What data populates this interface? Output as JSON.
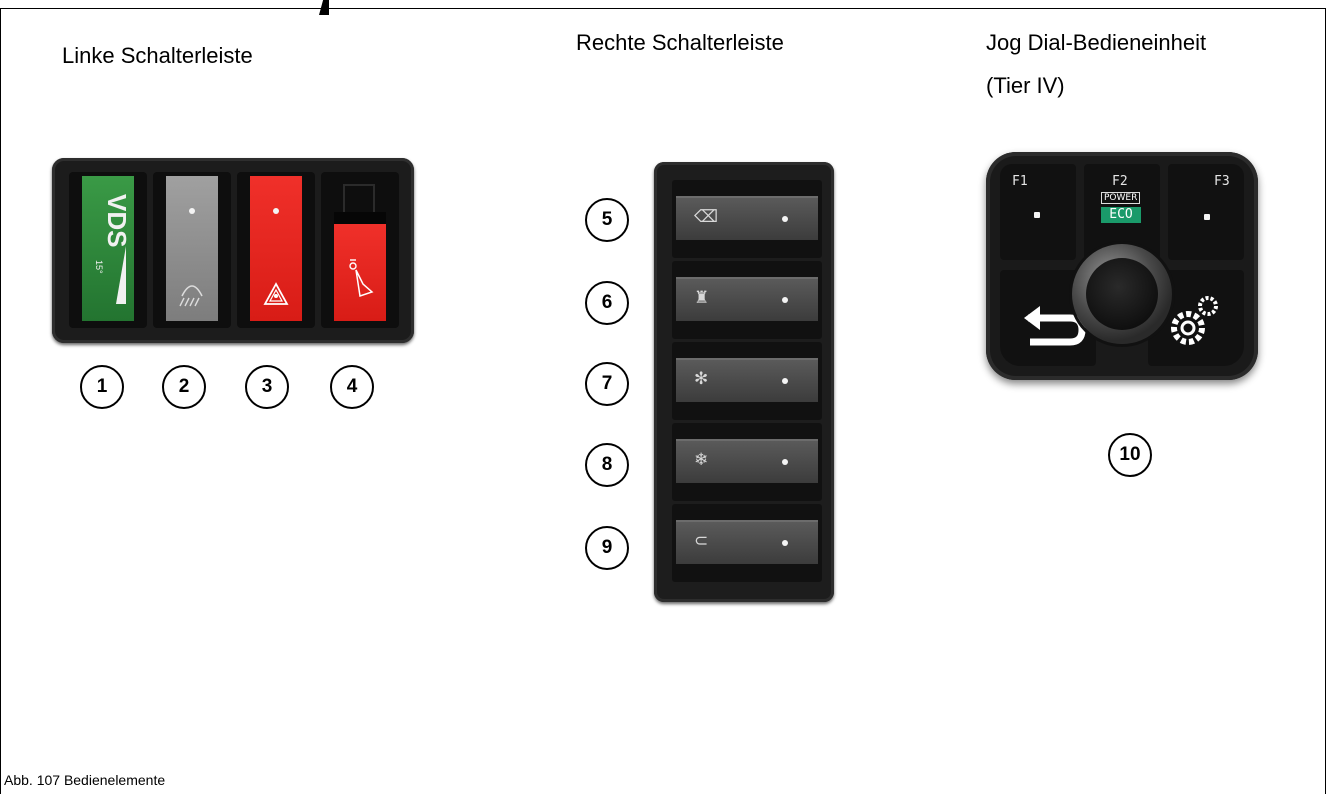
{
  "titles": {
    "left_bar": "Linke Schalterleiste",
    "right_bar": "Rechte Schalterleiste",
    "jog_line1": "Jog Dial-Bedieneinheit",
    "jog_line2": "(Tier IV)"
  },
  "left_switches": [
    {
      "number": "1",
      "color": "#2f8a3a",
      "icon": "vds-logo",
      "logo_text": "VDS",
      "logo_sup": "15°"
    },
    {
      "number": "2",
      "color": "#8e8e8e",
      "icon": "work-light-icon"
    },
    {
      "number": "3",
      "color": "#e8241c",
      "icon": "hazard-warning-icon"
    },
    {
      "number": "4",
      "color": "#e8241c",
      "icon": "boom-lock-icon"
    }
  ],
  "right_switches": [
    {
      "number": "5",
      "icon": "wiper-icon",
      "glyph": "⌫"
    },
    {
      "number": "6",
      "icon": "rotating-beacon-icon",
      "glyph": "♜"
    },
    {
      "number": "7",
      "icon": "fan-icon",
      "glyph": "✻"
    },
    {
      "number": "8",
      "icon": "air-conditioning-icon",
      "glyph": "❄"
    },
    {
      "number": "9",
      "icon": "horn-icon",
      "glyph": "⊂"
    }
  ],
  "jog_dial": {
    "number": "10",
    "f1": "F1",
    "f2": "F2",
    "f3": "F3",
    "power_label": "POWER",
    "eco_label": "ECO",
    "eco_color": "#1a9a6a",
    "back_icon": "back-arrow-icon",
    "settings_icon": "gear-icon"
  },
  "caption": "Abb. 107 Bedienelemente"
}
